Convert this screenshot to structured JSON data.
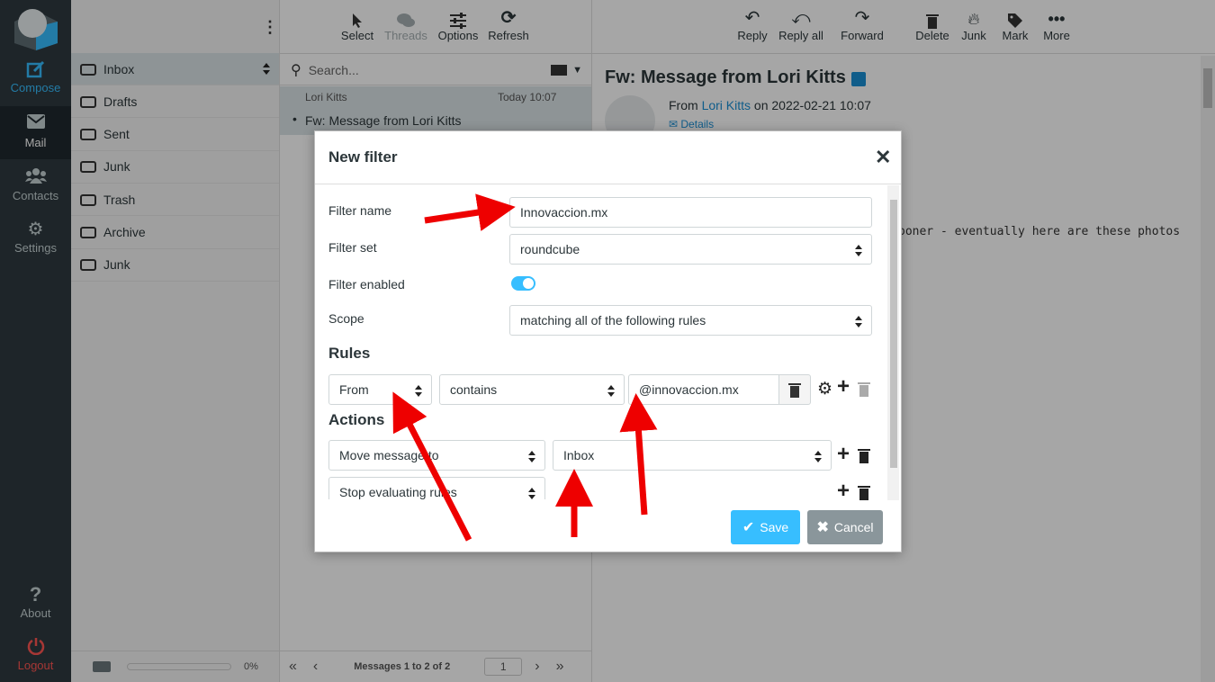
{
  "nav": {
    "compose": "Compose",
    "mail": "Mail",
    "contacts": "Contacts",
    "settings": "Settings",
    "about": "About",
    "logout": "Logout"
  },
  "folders": {
    "items": [
      {
        "label": "Inbox",
        "icon": "inbox-icon"
      },
      {
        "label": "Drafts",
        "icon": "pencil-icon"
      },
      {
        "label": "Sent",
        "icon": "paper-plane-icon"
      },
      {
        "label": "Junk",
        "icon": "fire-icon"
      },
      {
        "label": "Trash",
        "icon": "trash-icon"
      },
      {
        "label": "Archive",
        "icon": "folder-icon"
      },
      {
        "label": "Junk",
        "icon": "folder-icon"
      }
    ],
    "quota": "0%"
  },
  "list_toolbar": {
    "select": "Select",
    "threads": "Threads",
    "options": "Options",
    "refresh": "Refresh"
  },
  "search": {
    "placeholder": "Search..."
  },
  "messages": [
    {
      "from": "Lori Kitts",
      "date": "Today 10:07",
      "subject": "Fw: Message from Lori Kitts"
    }
  ],
  "pager": {
    "text": "Messages 1 to 2 of 2",
    "page": "1"
  },
  "viewer_toolbar": {
    "reply": "Reply",
    "reply_all": "Reply all",
    "forward": "Forward",
    "delete": "Delete",
    "junk": "Junk",
    "mark": "Mark",
    "more": "More"
  },
  "message": {
    "subject": "Fw: Message from Lori Kitts",
    "from_prefix": "From",
    "sender": "Lori Kitts",
    "date_text": "on 2022-02-21 10:07",
    "details": "Details",
    "body_fragment": "ooner - eventually here are these photos"
  },
  "dialog": {
    "title": "New filter",
    "filter_name_label": "Filter name",
    "filter_name_value": "Innovaccion.mx",
    "filter_set_label": "Filter set",
    "filter_set_value": "roundcube",
    "filter_enabled_label": "Filter enabled",
    "filter_enabled": true,
    "scope_label": "Scope",
    "scope_value": "matching all of the following rules",
    "rules_heading": "Rules",
    "rule_header": "From",
    "rule_op": "contains",
    "rule_value": "@innovaccion.mx",
    "actions_heading": "Actions",
    "action1": "Move message to",
    "action1_target": "Inbox",
    "action2": "Stop evaluating rules",
    "save": "Save",
    "cancel": "Cancel"
  },
  "colors": {
    "accent": "#37beff",
    "nav_bg": "#2f3a3f",
    "logout": "#ff5552",
    "arrow": "#ee0000"
  }
}
